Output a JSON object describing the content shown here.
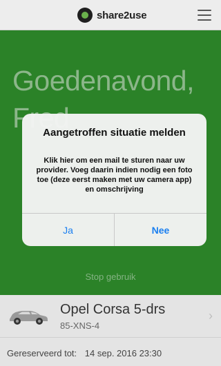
{
  "header": {
    "logo_text": "share2use",
    "menu_icon": "hamburger-icon"
  },
  "main": {
    "greeting": "Goedenavond, Fred",
    "stop_label": "Stop gebruik"
  },
  "dialog": {
    "title": "Aangetroffen situatie melden",
    "message": "Klik hier om een mail te sturen naar uw provider. Voeg daarin indien nodig een foto toe (deze eerst maken met uw camera app) en omschrijving",
    "yes_label": "Ja",
    "no_label": "Nee",
    "button_color": "#1a7ff0"
  },
  "car": {
    "name": "Opel Corsa 5-drs",
    "plate": "85-XNS-4",
    "icon": "car-icon",
    "chevron_icon": "chevron-right-icon"
  },
  "reservation": {
    "label": "Gereserveerd tot:",
    "value": "14 sep. 2016 23:30"
  },
  "colors": {
    "brand_green": "#2f8f2c",
    "logo_green": "#6ab04c"
  }
}
